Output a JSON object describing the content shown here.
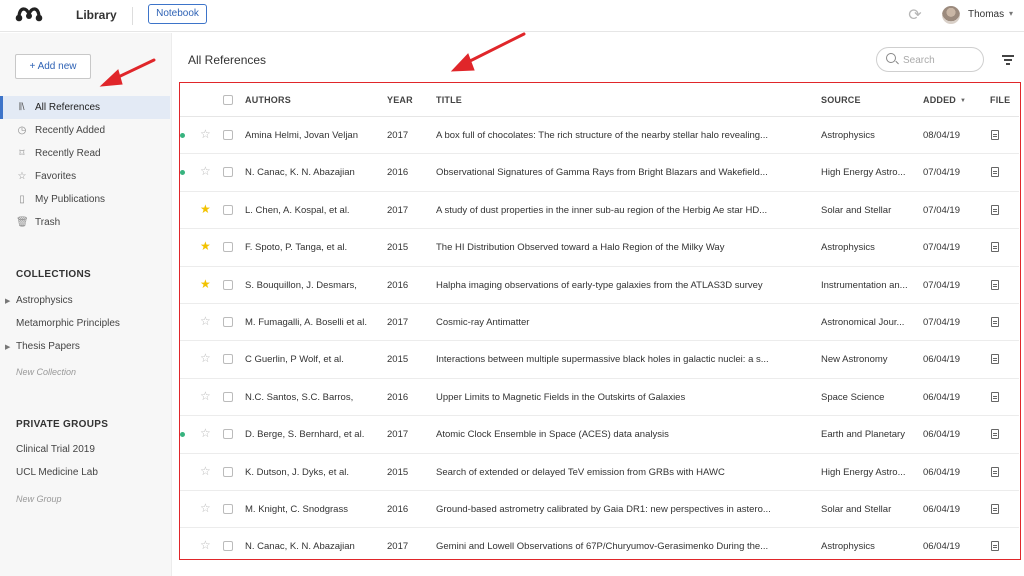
{
  "app": {
    "title": "Library",
    "notebook_label": "Notebook"
  },
  "user": {
    "name": "Thomas"
  },
  "sidebar": {
    "add_new_label": "+ Add new",
    "nav": [
      {
        "label": "All References",
        "icon": "library-icon",
        "glyph": "𝄃\\",
        "active": true
      },
      {
        "label": "Recently Added",
        "icon": "clock-icon",
        "glyph": "◷",
        "active": false
      },
      {
        "label": "Recently Read",
        "icon": "bookmark-icon",
        "glyph": "⌑",
        "active": false
      },
      {
        "label": "Favorites",
        "icon": "star-icon",
        "glyph": "☆",
        "active": false
      },
      {
        "label": "My Publications",
        "icon": "document-icon",
        "glyph": "▯",
        "active": false
      },
      {
        "label": "Trash",
        "icon": "trash-icon",
        "glyph": "🗑",
        "active": false
      }
    ],
    "collections_heading": "COLLECTIONS",
    "collections": [
      {
        "label": "Astrophysics",
        "expandable": true
      },
      {
        "label": "Metamorphic Principles",
        "expandable": false
      },
      {
        "label": "Thesis Papers",
        "expandable": true
      }
    ],
    "new_collection_label": "New Collection",
    "groups_heading": "PRIVATE GROUPS",
    "groups": [
      {
        "label": "Clinical Trial 2019"
      },
      {
        "label": "UCL Medicine Lab"
      }
    ],
    "new_group_label": "New Group"
  },
  "main": {
    "title": "All References",
    "search_placeholder": "Search",
    "columns": {
      "authors": "AUTHORS",
      "year": "YEAR",
      "title": "TITLE",
      "source": "SOURCE",
      "added": "ADDED",
      "file": "FILE"
    },
    "rows": [
      {
        "dot": true,
        "starred": false,
        "authors": "Amina Helmi, Jovan Veljan",
        "year": "2017",
        "title": "A box full of chocolates: The rich structure of the nearby stellar halo revealing...",
        "source": "Astrophysics",
        "added": "08/04/19"
      },
      {
        "dot": true,
        "starred": false,
        "authors": "N. Canac, K. N. Abazajian",
        "year": "2016",
        "title": "Observational Signatures of Gamma Rays from Bright Blazars and Wakefield...",
        "source": "High Energy Astro...",
        "added": "07/04/19"
      },
      {
        "dot": false,
        "starred": true,
        "authors": "L. Chen, A. Kospal, et al.",
        "year": "2017",
        "title": "A study of dust properties in the inner sub-au region of the Herbig Ae star HD...",
        "source": "Solar and Stellar",
        "added": "07/04/19"
      },
      {
        "dot": false,
        "starred": true,
        "authors": "F. Spoto, P. Tanga, et al.",
        "year": "2015",
        "title": "The HI Distribution Observed toward a Halo Region of the Milky Way",
        "source": "Astrophysics",
        "added": "07/04/19"
      },
      {
        "dot": false,
        "starred": true,
        "authors": "S. Bouquillon, J. Desmars,",
        "year": "2016",
        "title": "Halpha imaging observations of early-type galaxies from the ATLAS3D survey",
        "source": "Instrumentation an...",
        "added": "07/04/19"
      },
      {
        "dot": false,
        "starred": false,
        "authors": "M. Fumagalli, A. Boselli et al.",
        "year": "2017",
        "title": "Cosmic-ray Antimatter",
        "source": "Astronomical Jour...",
        "added": "07/04/19"
      },
      {
        "dot": false,
        "starred": false,
        "authors": "C Guerlin, P Wolf, et al.",
        "year": "2015",
        "title": "Interactions between multiple supermassive black holes in galactic nuclei: a s...",
        "source": "New Astronomy",
        "added": "06/04/19"
      },
      {
        "dot": false,
        "starred": false,
        "authors": "N.C. Santos, S.C. Barros,",
        "year": "2016",
        "title": "Upper Limits to Magnetic Fields in the Outskirts of Galaxies",
        "source": "Space Science",
        "added": "06/04/19"
      },
      {
        "dot": true,
        "starred": false,
        "authors": "D. Berge, S. Bernhard, et al.",
        "year": "2017",
        "title": "Atomic Clock Ensemble in Space (ACES) data analysis",
        "source": "Earth and Planetary",
        "added": "06/04/19"
      },
      {
        "dot": false,
        "starred": false,
        "authors": "K. Dutson, J. Dyks, et al.",
        "year": "2015",
        "title": "Search of extended or delayed TeV emission from GRBs with HAWC",
        "source": "High Energy Astro...",
        "added": "06/04/19"
      },
      {
        "dot": false,
        "starred": false,
        "authors": "M. Knight, C. Snodgrass",
        "year": "2016",
        "title": "Ground-based astrometry calibrated by Gaia DR1: new perspectives in astero...",
        "source": "Solar and Stellar",
        "added": "06/04/19"
      },
      {
        "dot": false,
        "starred": false,
        "authors": "N. Canac, K. N. Abazajian",
        "year": "2017",
        "title": "Gemini and Lowell Observations of 67P/Churyumov-Gerasimenko During the...",
        "source": "Astrophysics",
        "added": "06/04/19"
      }
    ]
  },
  "colors": {
    "accent": "#3d74c9",
    "annotation": "#e0262a",
    "star_on": "#f2c200",
    "unread_dot": "#37b37e"
  }
}
